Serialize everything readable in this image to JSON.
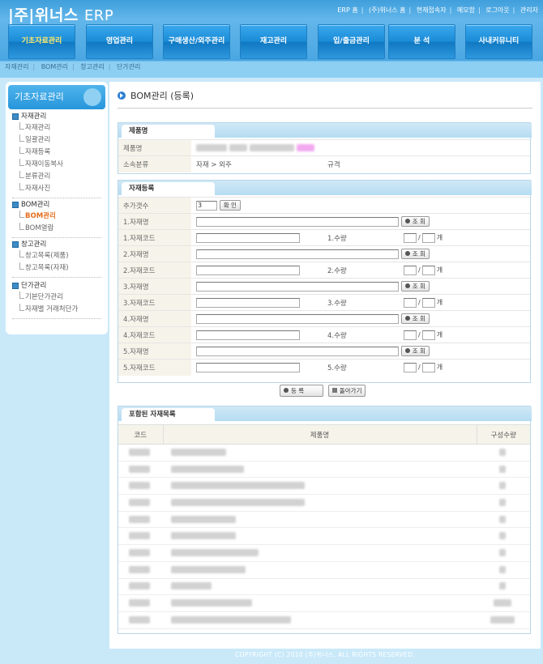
{
  "header": {
    "logo_main": "|주|위너스",
    "logo_erp": "ERP",
    "top_links": [
      "ERP 홈",
      "(주)위너스 홈",
      "현재접속자",
      "메모함",
      "로그아웃",
      "관리자"
    ]
  },
  "gnb": [
    {
      "label": "기초자료관리",
      "active": true
    },
    {
      "label": "영업관리",
      "active": false
    },
    {
      "label": "구매생산/외주관리",
      "active": false
    },
    {
      "label": "재고관리",
      "active": false
    },
    {
      "label": "입/출금관리",
      "active": false
    },
    {
      "label": "분 석",
      "active": false
    },
    {
      "label": "사내커뮤니티",
      "active": false
    }
  ],
  "subnav": [
    "자재관리",
    "BOM관리",
    "창고관리",
    "단가관리"
  ],
  "sidebar": {
    "title": "기초자료관리",
    "groups": [
      {
        "title": "자재관리",
        "items": [
          "자재관리",
          "일괄관리",
          "자재등록",
          "자재이동복사",
          "분류관리",
          "자재사진"
        ]
      },
      {
        "title": "BOM관리",
        "items": [
          "BOM관리",
          "BOM열람"
        ]
      },
      {
        "title": "창고관리",
        "items": [
          "창고목록(제품)",
          "창고목록(자재)"
        ]
      },
      {
        "title": "단가관리",
        "items": [
          "기본단가관리",
          "자재별 거래처단가"
        ]
      }
    ]
  },
  "page": {
    "title": "BOM관리 (등록)"
  },
  "product_box": {
    "tab": "제품명",
    "name_label": "제품명",
    "category_label": "소속분류",
    "category_value": "자재 > 외주",
    "spec_label": "규격"
  },
  "material_box": {
    "tab": "자재등록",
    "add_count_label": "추가갯수",
    "add_count_value": "3",
    "confirm_button": "확 인",
    "search_button": "조 회",
    "unit_label": "개",
    "rows": [
      {
        "name_label": "1.자재명",
        "code_label": "1.자재코드",
        "qty_label": "1.수량"
      },
      {
        "name_label": "2.자재명",
        "code_label": "2.자재코드",
        "qty_label": "2.수량"
      },
      {
        "name_label": "3.자재명",
        "code_label": "3.자재코드",
        "qty_label": "3.수량"
      },
      {
        "name_label": "4.자재명",
        "code_label": "4.자재코드",
        "qty_label": "4.수량"
      },
      {
        "name_label": "5.자재명",
        "code_label": "5.자재코드",
        "qty_label": "5.수량"
      }
    ]
  },
  "actions": {
    "register": "등 록",
    "back": "돌아가기"
  },
  "included_box": {
    "tab": "포함된 자재목록",
    "columns": [
      "코드",
      "제품명",
      "구성수량"
    ]
  },
  "footer": "COPYRIGHT (C) 2010 (주)위너스. ALL RIGHTS RESERVED."
}
